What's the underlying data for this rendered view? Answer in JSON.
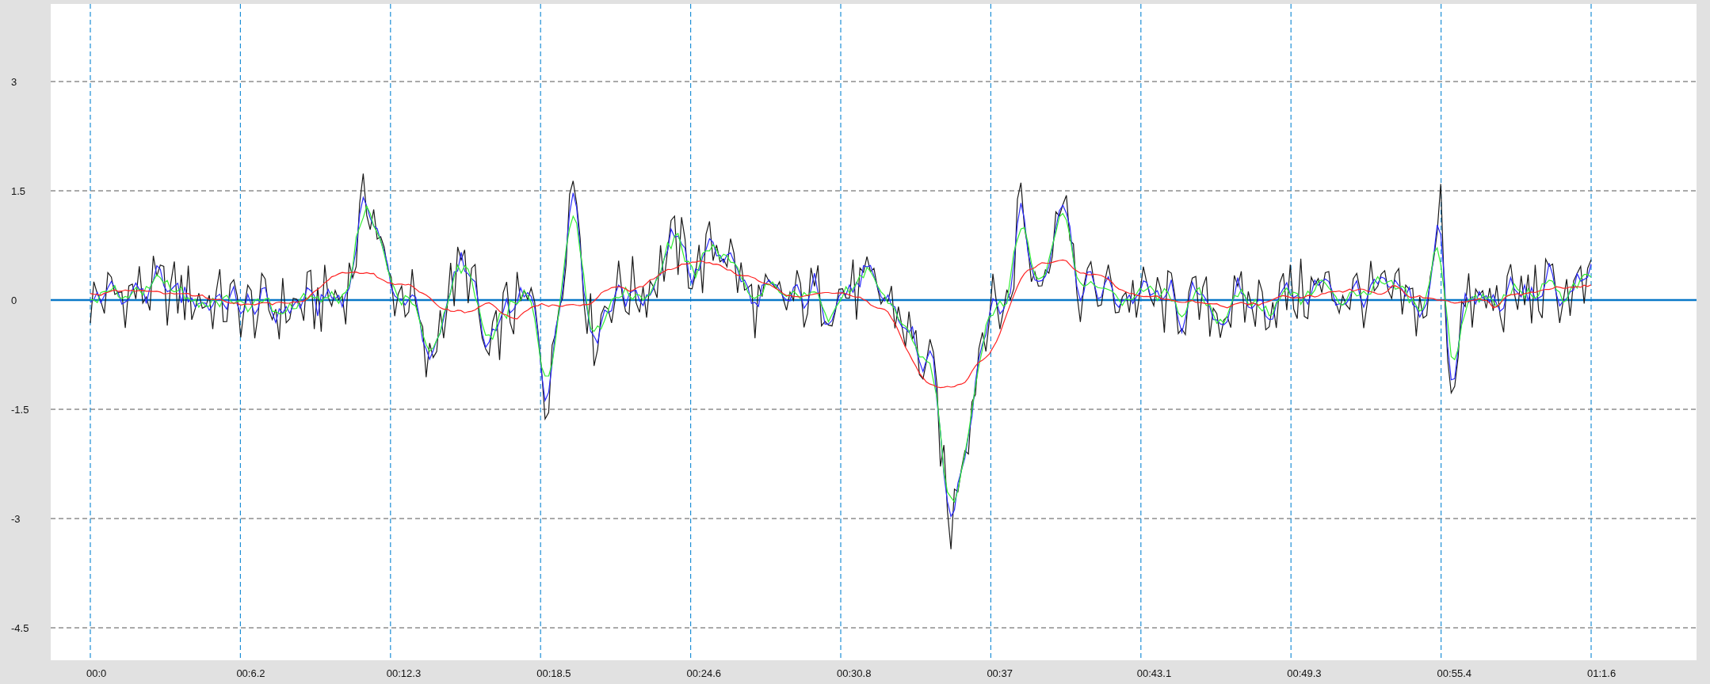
{
  "chart": {
    "y_ticks": [
      "3",
      "1.5",
      "0",
      "-1.5",
      "-3",
      "-4.5"
    ],
    "x_ticks": [
      "00:0",
      "00:6.2",
      "00:12.3",
      "00:18.5",
      "00:24.6",
      "00:30.8",
      "00:37",
      "00:43.1",
      "00:49.3",
      "00:55.4",
      "01:1.6"
    ],
    "traces": [
      {
        "color": "#1a1a1a"
      },
      {
        "color": "#2a2aff"
      },
      {
        "color": "#33ee33"
      },
      {
        "color": "#ff2222"
      }
    ]
  }
}
